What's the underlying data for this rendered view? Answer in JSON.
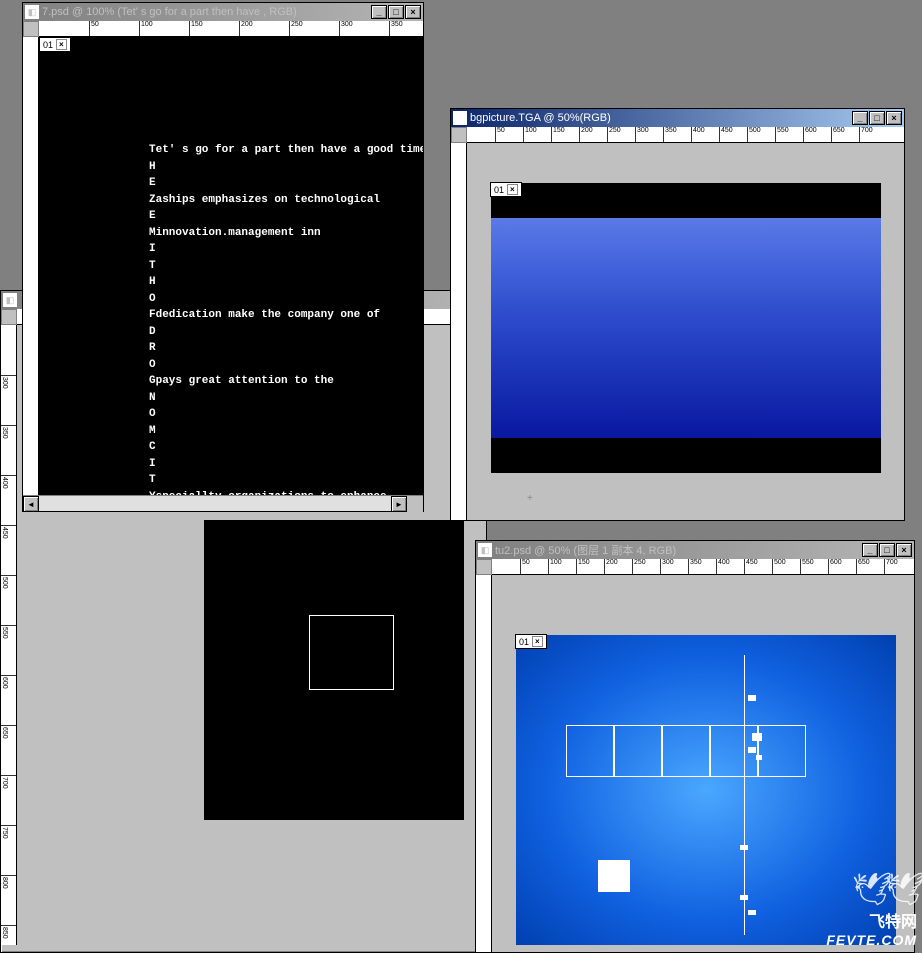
{
  "ruler_marks_h1": [
    "50",
    "100",
    "150",
    "200",
    "250",
    "300",
    "350"
  ],
  "ruler_marks_v_bg": [
    "300",
    "350",
    "400",
    "450",
    "500",
    "550",
    "600",
    "650",
    "700",
    "750",
    "800",
    "850"
  ],
  "windows": {
    "bgMain": {
      "title": "",
      "tab": "01",
      "doc1": {
        "lines": [
          "Tet' s go for a part then have a good time",
          "H",
          "E",
          "Zaships emphasizes on technological",
          "E",
          "Minnovation.management inn",
          "I",
          "T",
          "H",
          "O",
          "Fdedication make the company one of",
          "D",
          "R",
          "O",
          "Gpays great attention to the",
          "N",
          "O",
          "M",
          "C",
          "I",
          "T",
          "Yspeciallty organizations to enhance"
        ]
      }
    },
    "win1": {
      "title": "7.psd @ 100% (Tet' s go for a part then have , RGB)",
      "tab": "01"
    },
    "win2": {
      "title": "bgpicture.TGA @ 50%(RGB)",
      "tab": "01",
      "ruler_h": [
        "50",
        "100",
        "150",
        "200",
        "250",
        "300",
        "350",
        "400",
        "450",
        "500",
        "550",
        "600",
        "650",
        "700"
      ]
    },
    "win3": {
      "title": "tu2.psd @ 50% (图层 1 副本 4, RGB)",
      "tab": "01",
      "ruler_h": [
        "50",
        "100",
        "150",
        "200",
        "250",
        "300",
        "350",
        "400",
        "450",
        "500",
        "550",
        "600",
        "650",
        "700"
      ]
    }
  },
  "watermark": {
    "text": "飞特网",
    "url": "FEVTE.COM"
  },
  "buttons": {
    "minimize": "_",
    "maximize": "□",
    "close": "×",
    "left": "◄",
    "right": "►",
    "up": "▲",
    "down": "▼"
  }
}
